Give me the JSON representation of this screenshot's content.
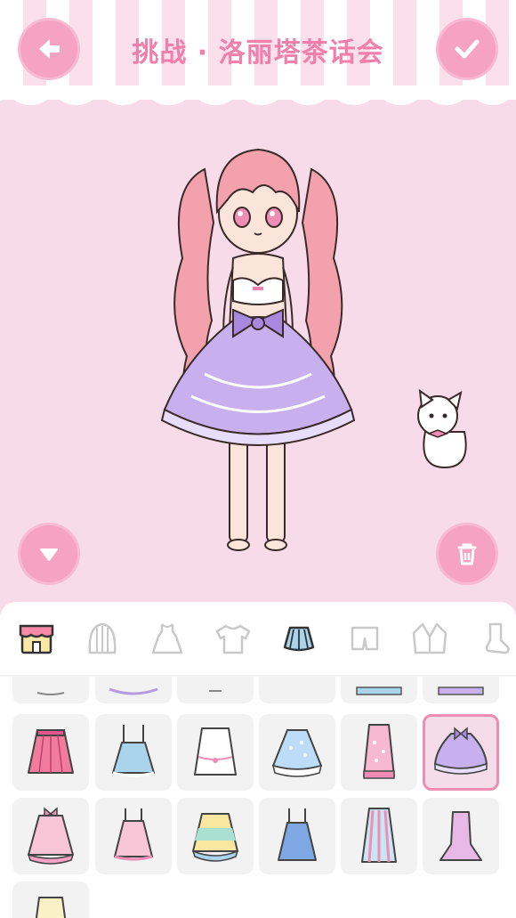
{
  "header": {
    "title": "挑战 · 洛丽塔茶话会",
    "back_icon": "arrow-left-icon",
    "confirm_icon": "checkmark-icon"
  },
  "stage": {
    "collapse_icon": "triangle-down-icon",
    "trash_icon": "trash-icon",
    "pet": "white-cat"
  },
  "categories": [
    "shop",
    "hair",
    "dress",
    "top",
    "skirt",
    "shorts",
    "jacket",
    "socks"
  ],
  "selected_category": "skirt",
  "items": {
    "rows": 3,
    "selected_item": "row1-col6-purple-lolita-skirt"
  },
  "colors": {
    "accent": "#f6a3c3",
    "title": "#f17fac",
    "background": "#f7dbe9"
  }
}
